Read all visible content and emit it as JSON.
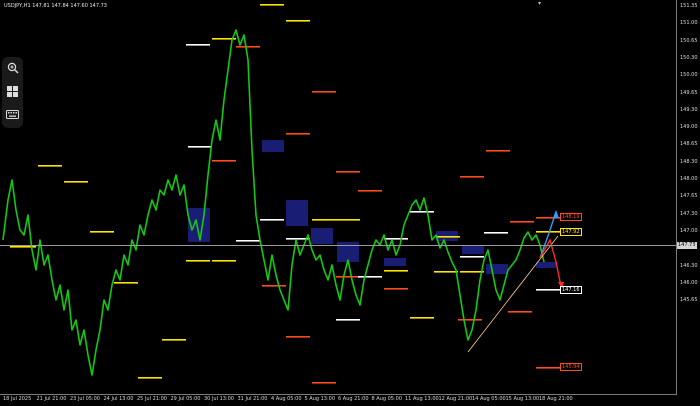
{
  "chart": {
    "symbol_label": "USDJPY,H1  147.81 147.84 147.60 147.73",
    "y_ticks": [
      "151.35",
      "151.00",
      "150.65",
      "150.30",
      "150.00",
      "149.65",
      "149.30",
      "149.00",
      "148.65",
      "148.30",
      "148.00",
      "147.65",
      "147.30",
      "147.00",
      "146.65",
      "146.30",
      "146.00",
      "145.65"
    ],
    "x_ticks": [
      "18 Jul 2025",
      "21 Jul 21:00",
      "23 Jul 05:00",
      "24 Jul 13:00",
      "25 Jul 21:00",
      "29 Jul 05:00",
      "30 Jul 13:00",
      "31 Jul 21:00",
      "4 Aug 05:00",
      "5 Aug 13:00",
      "6 Aug 21:00",
      "8 Aug 05:00",
      "11 Aug 13:00",
      "12 Aug 21:00",
      "14 Aug 05:00",
      "15 Aug 13:00",
      "18 Aug 21:00"
    ],
    "current_price_label": "147.73",
    "target_labels": {
      "upper": "148.19",
      "mid": "147.92",
      "lower": "147.16",
      "bottom": "145.94"
    },
    "colors": {
      "candles": "#14c814",
      "resistance": "#ff4a1a",
      "support": "#ffe600",
      "pivot": "#ffffff",
      "zones": "#1b1f7a",
      "trendline": "#ffd27a",
      "bull_arrow": "#3399ff",
      "bear_arrow": "#ff2a2a"
    }
  },
  "toolbar": {
    "zoom_icon": "zoom-in-icon",
    "layout_icon": "grid-icon",
    "keyboard_icon": "keyboard-icon"
  }
}
